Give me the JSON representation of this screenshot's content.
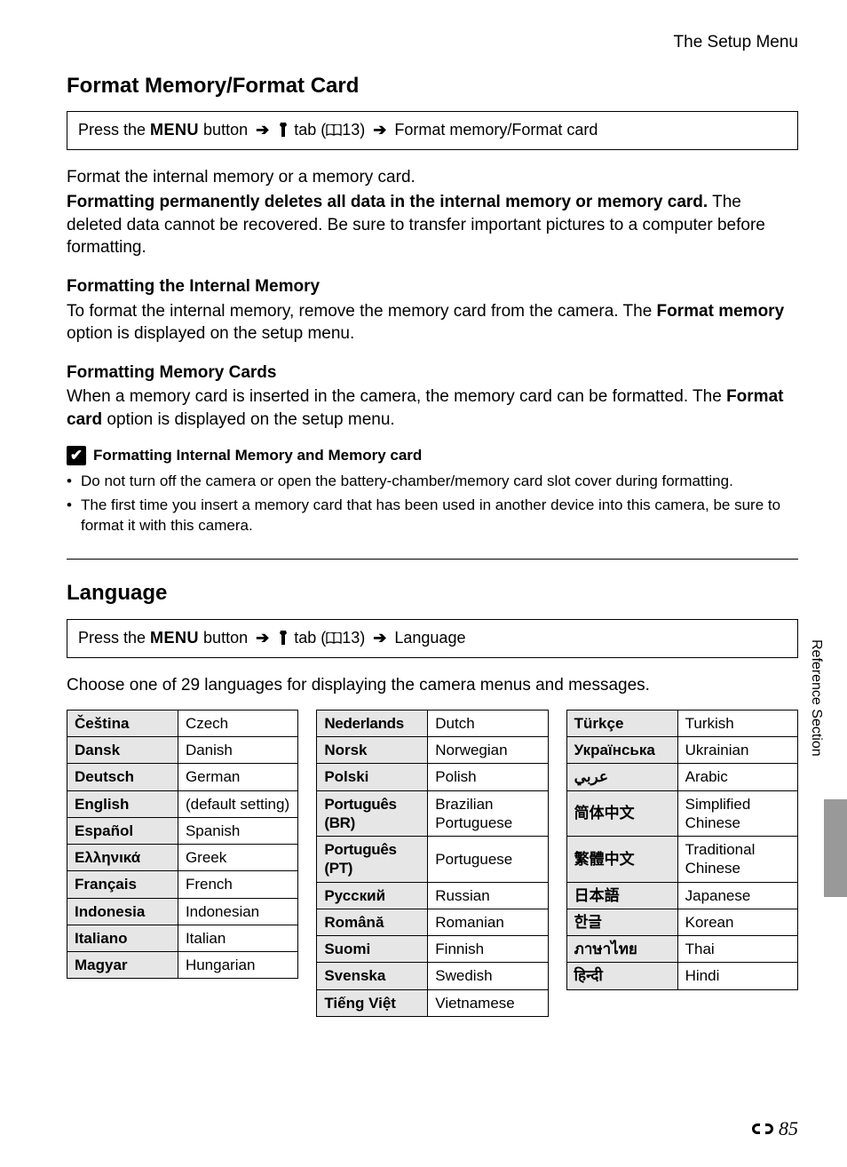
{
  "header": {
    "right": "The Setup Menu"
  },
  "section1": {
    "title": "Format Memory/Format Card",
    "nav": {
      "prefix": "Press the ",
      "menu": "MENU",
      "after_menu": " button ",
      "tab_after": " tab (",
      "page_ref": "13",
      "after_ref": ") ",
      "dest": "Format memory/Format card"
    },
    "p1": "Format the internal memory or a memory card.",
    "p2_bold": "Formatting permanently deletes all data in the internal memory or memory card.",
    "p2_rest": " The deleted data cannot be recovered. Be sure to transfer important pictures to a computer before formatting.",
    "sub1_title": "Formatting the Internal Memory",
    "sub1_text_a": "To format the internal memory, remove the memory card from the camera. The ",
    "sub1_bold": "Format memory",
    "sub1_text_b": " option is displayed on the setup menu.",
    "sub2_title": "Formatting Memory Cards",
    "sub2_text_a": "When a memory card is inserted in the camera, the memory card can be formatted. The ",
    "sub2_bold": "Format card",
    "sub2_text_b": " option is displayed on the setup menu.",
    "note_title": "Formatting Internal Memory and Memory card",
    "note_items": [
      "Do not turn off the camera or open the battery-chamber/memory card slot cover during formatting.",
      "The first time you insert a memory card that has been used in another device into this camera, be sure to format it with this camera."
    ]
  },
  "section2": {
    "title": "Language",
    "nav": {
      "prefix": "Press the ",
      "menu": "MENU",
      "after_menu": " button ",
      "tab_after": " tab (",
      "page_ref": "13",
      "after_ref": ") ",
      "dest": "Language"
    },
    "intro": "Choose one of 29 languages for displaying the camera menus and messages.",
    "columns": [
      [
        {
          "native": "Čeština",
          "name": "Czech"
        },
        {
          "native": "Dansk",
          "name": "Danish"
        },
        {
          "native": "Deutsch",
          "name": "German"
        },
        {
          "native": "English",
          "name": "(default setting)"
        },
        {
          "native": "Español",
          "name": "Spanish"
        },
        {
          "native": "Ελληνικά",
          "name": "Greek"
        },
        {
          "native": "Français",
          "name": "French"
        },
        {
          "native": "Indonesia",
          "name": "Indonesian"
        },
        {
          "native": "Italiano",
          "name": "Italian"
        },
        {
          "native": "Magyar",
          "name": "Hungarian"
        }
      ],
      [
        {
          "native": "Nederlands",
          "name": "Dutch",
          "condensed": true
        },
        {
          "native": "Norsk",
          "name": "Norwegian"
        },
        {
          "native": "Polski",
          "name": "Polish"
        },
        {
          "native": "Português (BR)",
          "name": "Brazilian Portuguese",
          "condensed": true
        },
        {
          "native": "Português (PT)",
          "name": "Portuguese",
          "condensed": true
        },
        {
          "native": "Русский",
          "name": "Russian"
        },
        {
          "native": "Română",
          "name": "Romanian"
        },
        {
          "native": "Suomi",
          "name": "Finnish"
        },
        {
          "native": "Svenska",
          "name": "Swedish"
        },
        {
          "native": "Tiếng Việt",
          "name": "Vietnamese"
        }
      ],
      [
        {
          "native": "Türkçe",
          "name": "Turkish"
        },
        {
          "native": "Українська",
          "name": "Ukrainian"
        },
        {
          "native": "عربي",
          "name": "Arabic"
        },
        {
          "native": "简体中文",
          "name": "Simplified Chinese"
        },
        {
          "native": "繁體中文",
          "name": "Traditional Chinese"
        },
        {
          "native": "日本語",
          "name": "Japanese"
        },
        {
          "native": "한글",
          "name": "Korean"
        },
        {
          "native": "ภาษาไทย",
          "name": "Thai"
        },
        {
          "native": "हिन्दी",
          "name": "Hindi"
        }
      ]
    ]
  },
  "side_label": "Reference Section",
  "page_number": "85"
}
